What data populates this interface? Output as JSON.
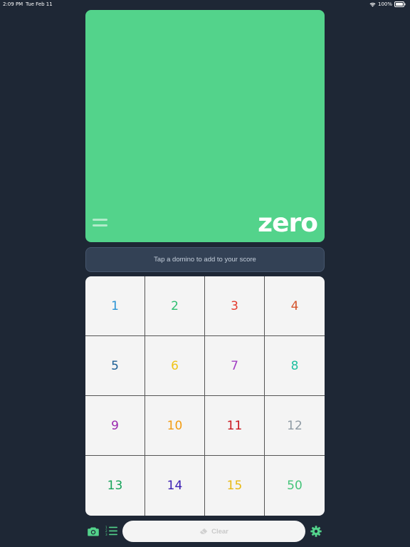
{
  "status_bar": {
    "time": "2:09 PM",
    "date": "Tue Feb 11",
    "battery": "100%"
  },
  "score": {
    "value": "zero",
    "background": "#53d38b"
  },
  "hint": {
    "text": "Tap a domino to add to your score"
  },
  "dominoes": [
    {
      "label": "1",
      "color": "#2a93d5"
    },
    {
      "label": "2",
      "color": "#2fbf71"
    },
    {
      "label": "3",
      "color": "#e43a2e"
    },
    {
      "label": "4",
      "color": "#d4532b"
    },
    {
      "label": "5",
      "color": "#1b5e95"
    },
    {
      "label": "6",
      "color": "#f0c419"
    },
    {
      "label": "7",
      "color": "#a13fc4"
    },
    {
      "label": "8",
      "color": "#1fbfa0"
    },
    {
      "label": "9",
      "color": "#9b27af"
    },
    {
      "label": "10",
      "color": "#f39c12"
    },
    {
      "label": "11",
      "color": "#c9171e"
    },
    {
      "label": "12",
      "color": "#8e9aa4"
    },
    {
      "label": "13",
      "color": "#16a35a"
    },
    {
      "label": "14",
      "color": "#3b1fb3"
    },
    {
      "label": "15",
      "color": "#e8b913"
    },
    {
      "label": "50",
      "color": "#45c47a"
    }
  ],
  "toolbar": {
    "clear_label": "Clear",
    "icons": [
      "camera-icon",
      "list-icon",
      "eraser-icon",
      "gear-icon"
    ],
    "accent": "#53d38b"
  }
}
